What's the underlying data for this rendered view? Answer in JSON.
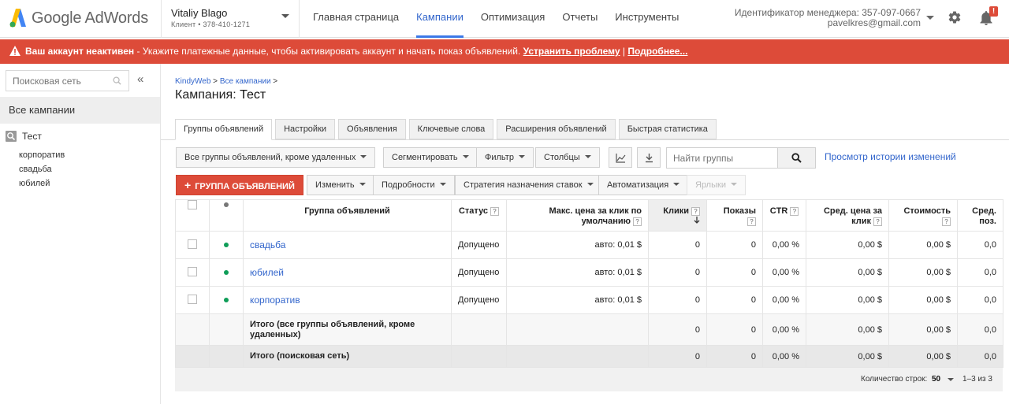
{
  "app": {
    "logo_text": "Google AdWords"
  },
  "account": {
    "name": "Vitaliy Blago",
    "client_line": "Клиент  •  378-410-1271"
  },
  "nav": [
    {
      "label": "Главная страница"
    },
    {
      "label": "Кампании"
    },
    {
      "label": "Оптимизация"
    },
    {
      "label": "Отчеты"
    },
    {
      "label": "Инструменты"
    }
  ],
  "manager": {
    "id_line": "Идентификатор менеджера: 357-097-0667",
    "email": "pavelkres@gmail.com"
  },
  "notifications": {
    "badge": "!"
  },
  "alert": {
    "title": "Ваш аккаунт неактивен",
    "message": " - Укажите платежные данные, чтобы активировать аккаунт и начать показ объявлений. ",
    "fix_link": "Устранить проблему",
    "separator": " | ",
    "more_link": "Подробнее..."
  },
  "sidebar": {
    "search_placeholder": "Поисковая сеть",
    "collapse": "«",
    "all_campaigns": "Все кампании",
    "campaign": "Тест",
    "ad_groups": [
      "корпоратив",
      "свадьба",
      "юбилей"
    ]
  },
  "breadcrumb": {
    "root": "KindyWeb",
    "sep": " > ",
    "campaigns": "Все кампании",
    "tail": " >"
  },
  "page_title": {
    "label": "Кампания:",
    "value": "Тест"
  },
  "tabs": [
    {
      "label": "Группы объявлений"
    },
    {
      "label": "Настройки"
    },
    {
      "label": "Объявления"
    },
    {
      "label": "Ключевые слова"
    },
    {
      "label": "Расширения объявлений"
    },
    {
      "label": "Быстрая статистика"
    }
  ],
  "toolbar": {
    "filter_scope": "Все группы объявлений, кроме удаленных",
    "segment": "Сегментировать",
    "filter": "Фильтр",
    "columns": "Столбцы",
    "search_placeholder": "Найти группы",
    "history": "Просмотр истории изменений",
    "add_group": "ГРУППА ОБЪЯВЛЕНИЙ",
    "edit": "Изменить",
    "details": "Подробности",
    "bid_strategy": "Стратегия назначения ставок",
    "automation": "Автоматизация",
    "labels": "Ярлыки"
  },
  "table": {
    "headers": {
      "group": "Группа объявлений",
      "status": "Статус",
      "max_cpc": "Макс. цена за клик по умолчанию",
      "clicks": "Клики",
      "impr": "Показы",
      "ctr": "CTR",
      "avg_cpc": "Сред. цена за клик",
      "cost": "Стоимость",
      "avg_pos": "Сред. поз."
    },
    "help": "?",
    "rows": [
      {
        "group": "свадьба",
        "status": "Допущено",
        "max_cpc": "авто: 0,01 $",
        "clicks": "0",
        "impr": "0",
        "ctr": "0,00 %",
        "avg_cpc": "0,00 $",
        "cost": "0,00 $",
        "avg_pos": "0,0"
      },
      {
        "group": "юбилей",
        "status": "Допущено",
        "max_cpc": "авто: 0,01 $",
        "clicks": "0",
        "impr": "0",
        "ctr": "0,00 %",
        "avg_cpc": "0,00 $",
        "cost": "0,00 $",
        "avg_pos": "0,0"
      },
      {
        "group": "корпоратив",
        "status": "Допущено",
        "max_cpc": "авто: 0,01 $",
        "clicks": "0",
        "impr": "0",
        "ctr": "0,00 %",
        "avg_cpc": "0,00 $",
        "cost": "0,00 $",
        "avg_pos": "0,0"
      }
    ],
    "total_all": {
      "label": "Итого (все группы объявлений, кроме удаленных)",
      "clicks": "0",
      "impr": "0",
      "ctr": "0,00 %",
      "avg_cpc": "0,00 $",
      "cost": "0,00 $",
      "avg_pos": "0,0"
    },
    "total_search": {
      "label": "Итого (поисковая сеть)",
      "clicks": "0",
      "impr": "0",
      "ctr": "0,00 %",
      "avg_cpc": "0,00 $",
      "cost": "0,00 $",
      "avg_pos": "0,0"
    }
  },
  "pagination": {
    "rows_label": "Количество строк:",
    "rows_value": "50",
    "range": "1–3 из 3"
  },
  "colors": {
    "accent": "#3366cc",
    "alert": "#dd4b39",
    "status_ok": "#0f9d58"
  }
}
